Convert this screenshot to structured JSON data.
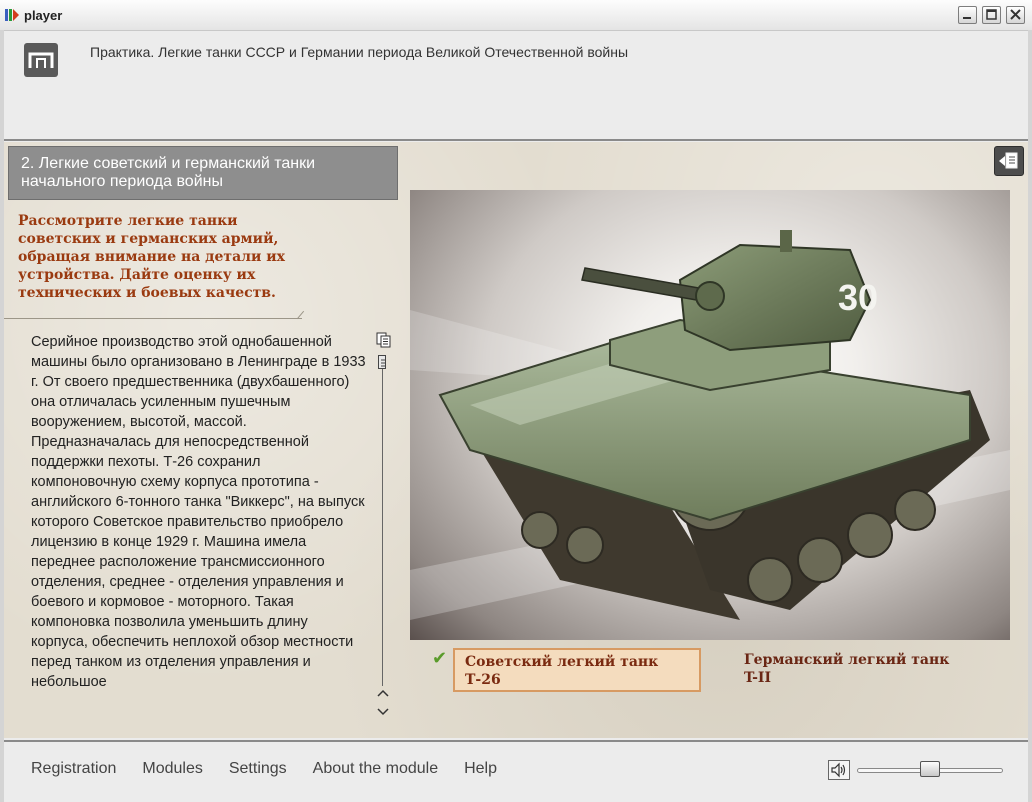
{
  "window": {
    "title": "player",
    "minimize_icon": "minimize-icon",
    "maximize_icon": "maximize-icon",
    "close_icon": "close-icon"
  },
  "header": {
    "logo_icon": "pi-logo-icon",
    "title": "Практика. Легкие танки СССР и Германии периода Великой Отечественной войны"
  },
  "section": {
    "title": "2. Легкие советский и германский танки начального периода войны"
  },
  "task": {
    "text": "Рассмотрите легкие танки советских и германских армий, обращая внимание на детали их устройства. Дайте оценку их технических и боевых качеств."
  },
  "description": {
    "text": "Серийное производство этой однобашенной машины было организовано в Ленинграде в 1933 г. От своего предшественника (двухбашенного) она отличалась усиленным пушечным вооружением, высотой, массой. Предназначалась для непосредственной поддержки пехоты. Т-26 сохранил компоновочную схему корпуса прототипа - английского 6-тонного танка \"Виккерс\", на выпуск которого Советское правительство приобрело лицензию в конце 1929 г. Машина имела переднее расположение трансмиссионного отделения, среднее - отделения управления и боевого и кормовое - моторного. Такая компоновка позволила уменьшить длину корпуса, обеспечить неплохой обзор местности перед танком из отделения управления и небольшое"
  },
  "photo": {
    "turret_number": "30",
    "subject": "tank-t26-photo"
  },
  "options": [
    {
      "line1": "Советский легкий танк",
      "line2": "Т-26",
      "selected": true
    },
    {
      "line1": "Германский легкий танк",
      "line2": "T-II",
      "selected": false
    }
  ],
  "footer": {
    "menu": [
      "Registration",
      "Modules",
      "Settings",
      "About the module",
      "Help"
    ],
    "volume_fraction": 0.5
  },
  "colors": {
    "task_text": "#9a3a10",
    "selected_border": "#d79a62",
    "selected_bg": "#f4dcbe",
    "check": "#5a9b2a"
  }
}
